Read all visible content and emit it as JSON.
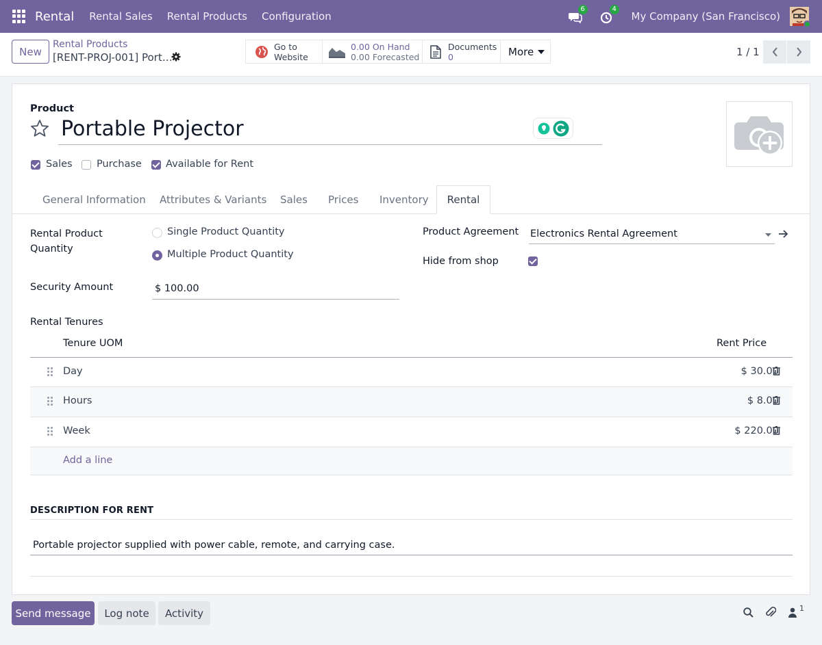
{
  "navbar": {
    "app_name": "Rental",
    "menu": [
      "Rental Sales",
      "Rental Products",
      "Configuration"
    ],
    "messages_count": "6",
    "activities_count": "4",
    "company": "My Company (San Francisco)"
  },
  "control_panel": {
    "new_label": "New",
    "breadcrumb_parent": "Rental Products",
    "breadcrumb_current": "[RENT-PROJ-001] Port…",
    "smart_buttons": {
      "website_line1": "Go to",
      "website_line2": "Website",
      "on_hand_value": "0.00",
      "on_hand_label": "On Hand",
      "forecasted_value": "0.00",
      "forecasted_label": "Forecasted",
      "documents_label": "Documents",
      "documents_count": "0",
      "more_label": "More"
    },
    "pager": "1 / 1"
  },
  "form": {
    "product_label": "Product",
    "product_name": "Portable Projector",
    "checkboxes": [
      {
        "label": "Sales",
        "checked": true
      },
      {
        "label": "Purchase",
        "checked": false
      },
      {
        "label": "Available for Rent",
        "checked": true
      }
    ],
    "tabs": [
      "General Information",
      "Attributes & Variants",
      "Sales",
      "Prices",
      "Inventory",
      "Rental"
    ],
    "active_tab": "Rental",
    "rental": {
      "quantity_label_line1": "Rental Product",
      "quantity_label_line2": "Quantity",
      "quantity_options": [
        {
          "label": "Single Product Quantity",
          "selected": false
        },
        {
          "label": "Multiple Product Quantity",
          "selected": true
        }
      ],
      "security_label": "Security Amount",
      "security_value": "$ 100.00",
      "agreement_label": "Product Agreement",
      "agreement_value": "Electronics Rental Agreement",
      "hide_label": "Hide from shop",
      "hide_checked": true,
      "tenures_label": "Rental Tenures",
      "tenures_columns": {
        "uom": "Tenure UOM",
        "price": "Rent Price"
      },
      "tenures": [
        {
          "uom": "Day",
          "price": "$ 30.00"
        },
        {
          "uom": "Hours",
          "price": "$ 8.00"
        },
        {
          "uom": "Week",
          "price": "$ 220.00"
        }
      ],
      "add_line": "Add a line",
      "description_header": "DESCRIPTION FOR RENT",
      "description_text": "Portable projector supplied with power cable, remote, and carrying case."
    }
  },
  "chatter": {
    "send_message": "Send message",
    "log_note": "Log note",
    "activity": "Activity",
    "followers_count": "1"
  },
  "colors": {
    "brand": "#71639e",
    "success": "#28a745"
  }
}
